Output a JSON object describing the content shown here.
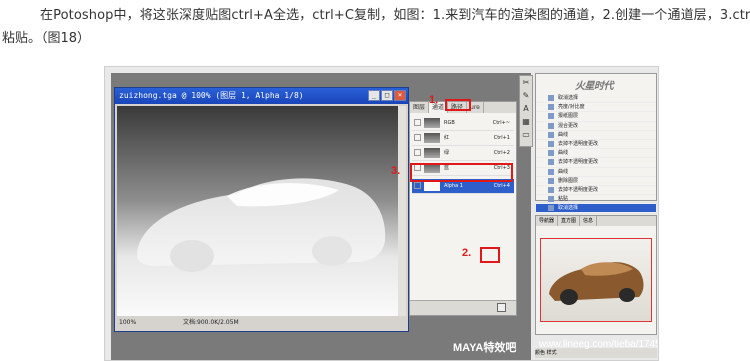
{
  "paragraph": {
    "line1": "在Potoshop中，将这张深度贴图ctrl+A全选，ctrl+C复制，如图：1.来到汽车的渲染图的通道，2.创建一个通道层，3.ctrl+V",
    "line2": "粘贴。（图18）"
  },
  "doc_window": {
    "title": "zuizhong.tga @ 100% (图层 1, Alpha 1/8)",
    "zoom": "100%",
    "doc_size": "文档:900.0K/2.05M"
  },
  "channels": {
    "tabs": [
      "图层",
      "通道",
      "路径",
      "ure"
    ],
    "rows": [
      {
        "name": "RGB",
        "shortcut": "Ctrl+~"
      },
      {
        "name": "红",
        "shortcut": "Ctrl+1"
      },
      {
        "name": "绿",
        "shortcut": "Ctrl+2"
      },
      {
        "name": "蓝",
        "shortcut": "Ctrl+3"
      },
      {
        "name": "Alpha 1",
        "shortcut": "Ctrl+4"
      }
    ]
  },
  "labels": {
    "one": "1.",
    "two": "2.",
    "three": "3."
  },
  "history": {
    "items": [
      "取消选择",
      "亮度/对比度",
      "报纸图层",
      "混合更改",
      "曲线",
      "去掉不透明度更改",
      "曲线",
      "去掉不透明度更改",
      "曲线",
      "删除图层",
      "去掉不透明度更改",
      "粘贴",
      "取消选择"
    ]
  },
  "navigator": {
    "tabs": [
      "导航器",
      "直方图",
      "信息"
    ]
  },
  "bottom_tabs": "颜色  样式",
  "logo": "火星时代",
  "watermark": "MAYA特效吧",
  "url": "www.lineeg.com/tieba/1745"
}
